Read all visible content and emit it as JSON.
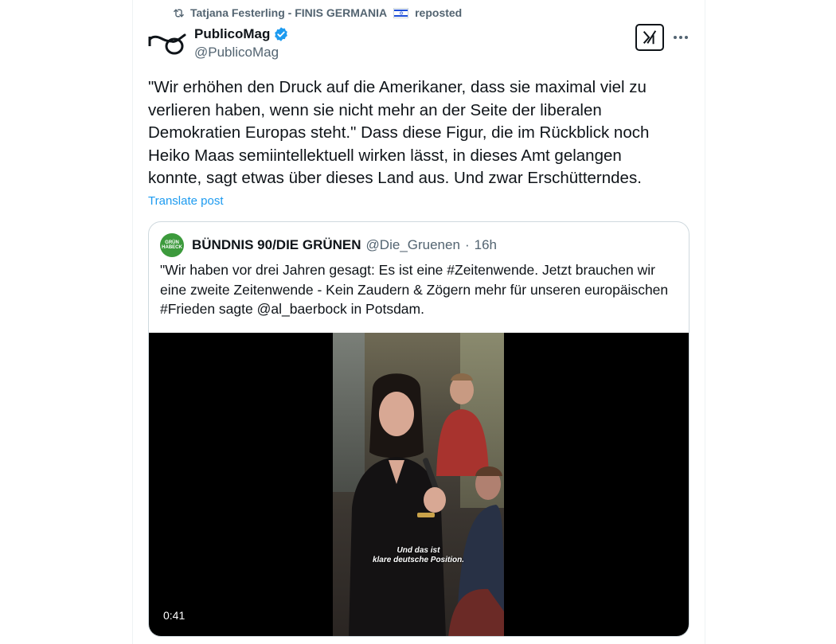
{
  "repost": {
    "icon": "repost-icon",
    "user": "Tatjana Festerling - FINIS GERMANIA",
    "flag": "israel-flag-emoji",
    "suffix": "reposted"
  },
  "post": {
    "author_name": "PublicoMag",
    "author_handle": "@PublicoMag",
    "verified": true,
    "text": "\"Wir erhöhen den Druck auf die Amerikaner, dass sie maximal viel zu verlieren haben, wenn sie nicht mehr an der Seite der liberalen Demokratien Europas steht.\" Dass diese Figur, die im Rückblick noch Heiko Maas semiintellektuell wirken lässt, in dieses Amt gelangen konnte, sagt etwas über dieses Land aus. Und zwar Erschütterndes.",
    "translate_label": "Translate post"
  },
  "quote": {
    "avatar_text": "GRÜN HABECK",
    "name": "BÜNDNIS 90/DIE GRÜNEN",
    "handle": "@Die_Gruenen",
    "separator": "·",
    "time": "16h",
    "text": "\"Wir haben vor drei Jahren gesagt: Es ist eine #Zeitenwende. Jetzt brauchen wir eine zweite Zeitenwende - Kein Zaudern & Zögern mehr für unseren europäischen #Frieden sagte @al_baerbock in Potsdam.",
    "video": {
      "subtitle_line1": "Und das ist",
      "subtitle_line2": "klare deutsche Position.",
      "duration": "0:41"
    }
  },
  "colors": {
    "text": "#0f1419",
    "secondary": "#536471",
    "link": "#1d9bf0",
    "border": "#cfd9de",
    "verified": "#1d9bf0"
  }
}
